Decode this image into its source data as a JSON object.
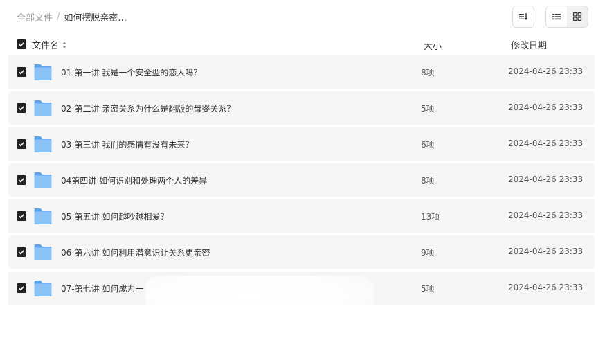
{
  "breadcrumb": {
    "root": "全部文件",
    "separator": "/",
    "current": "如何摆脱亲密..."
  },
  "toolbar": {
    "sort_icon": "sort-descending-icon",
    "list_view_icon": "list-view-icon",
    "grid_view_icon": "grid-view-icon",
    "active_view": "list"
  },
  "table": {
    "headers": {
      "name": "文件名",
      "size": "大小",
      "date": "修改日期"
    },
    "rows": [
      {
        "name": "01-第一讲 我是一个安全型的恋人吗？",
        "size": "8项",
        "date": "2024-04-26 23:33",
        "checked": true
      },
      {
        "name": "02-第二讲 亲密关系为什么是翻版的母婴关系？",
        "size": "5项",
        "date": "2024-04-26 23:33",
        "checked": true
      },
      {
        "name": "03-第三讲 我们的感情有没有未来？",
        "size": "6项",
        "date": "2024-04-26 23:33",
        "checked": true
      },
      {
        "name": "04第四讲 如何识别和处理两个人的差异",
        "size": "8项",
        "date": "2024-04-26 23:33",
        "checked": true
      },
      {
        "name": "05-第五讲 如何越吵越相爱？",
        "size": "13项",
        "date": "2024-04-26 23:33",
        "checked": true
      },
      {
        "name": "06-第六讲 如何利用潜意识让关系更亲密",
        "size": "9项",
        "date": "2024-04-26 23:33",
        "checked": true
      },
      {
        "name": "07-第七讲 如何成为一",
        "size": "5项",
        "date": "2024-04-26 23:33",
        "checked": true
      }
    ]
  },
  "colors": {
    "row_bg": "#f5f5f6",
    "folder": "#7fb8f5",
    "checkbox": "#222222"
  }
}
